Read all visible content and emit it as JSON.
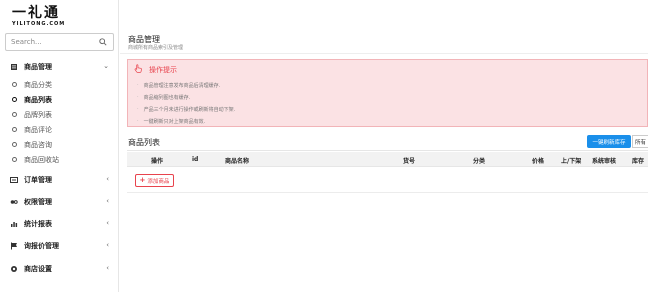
{
  "logo": {
    "mark": "一礼通",
    "sub": "YILITONG.COM"
  },
  "search": {
    "placeholder": "Search..."
  },
  "sidebar": {
    "goods": {
      "label": "商品管理",
      "items": [
        {
          "label": "商品分类",
          "active": false
        },
        {
          "label": "商品列表",
          "active": true
        },
        {
          "label": "品牌列表",
          "active": false
        },
        {
          "label": "商品评论",
          "active": false
        },
        {
          "label": "商品咨询",
          "active": false
        },
        {
          "label": "商品回收站",
          "active": false
        }
      ]
    },
    "collapsed": [
      {
        "label": "订单管理",
        "icon": "order-icon"
      },
      {
        "label": "权限管理",
        "icon": "permission-icon"
      },
      {
        "label": "统计报表",
        "icon": "chart-icon"
      },
      {
        "label": "询报价管理",
        "icon": "flag-icon"
      },
      {
        "label": "商店设置",
        "icon": "gear-icon"
      }
    ]
  },
  "header": {
    "title": "商品管理",
    "subtitle": "商城所有商品索引及管理"
  },
  "alert": {
    "title": "操作提示",
    "items": [
      "商品管理注意发布商品后清理缓存.",
      "商品缩列图也有缓存.",
      "产品三个月未进行操作或刷新将自动下架.",
      "一键刷新只对上架商品有效."
    ]
  },
  "list": {
    "title": "商品列表",
    "refresh_label": "一键刷新库存",
    "all_label": "所有",
    "columns": [
      "操作",
      "id",
      "商品名称",
      "货号",
      "分类",
      "价格",
      "上/下架",
      "系统审核",
      "库存"
    ],
    "add_label": "添加商品"
  },
  "colors": {
    "accent": "#1a8fea",
    "danger": "#e8434d",
    "alert_bg": "#fbe2e4"
  }
}
